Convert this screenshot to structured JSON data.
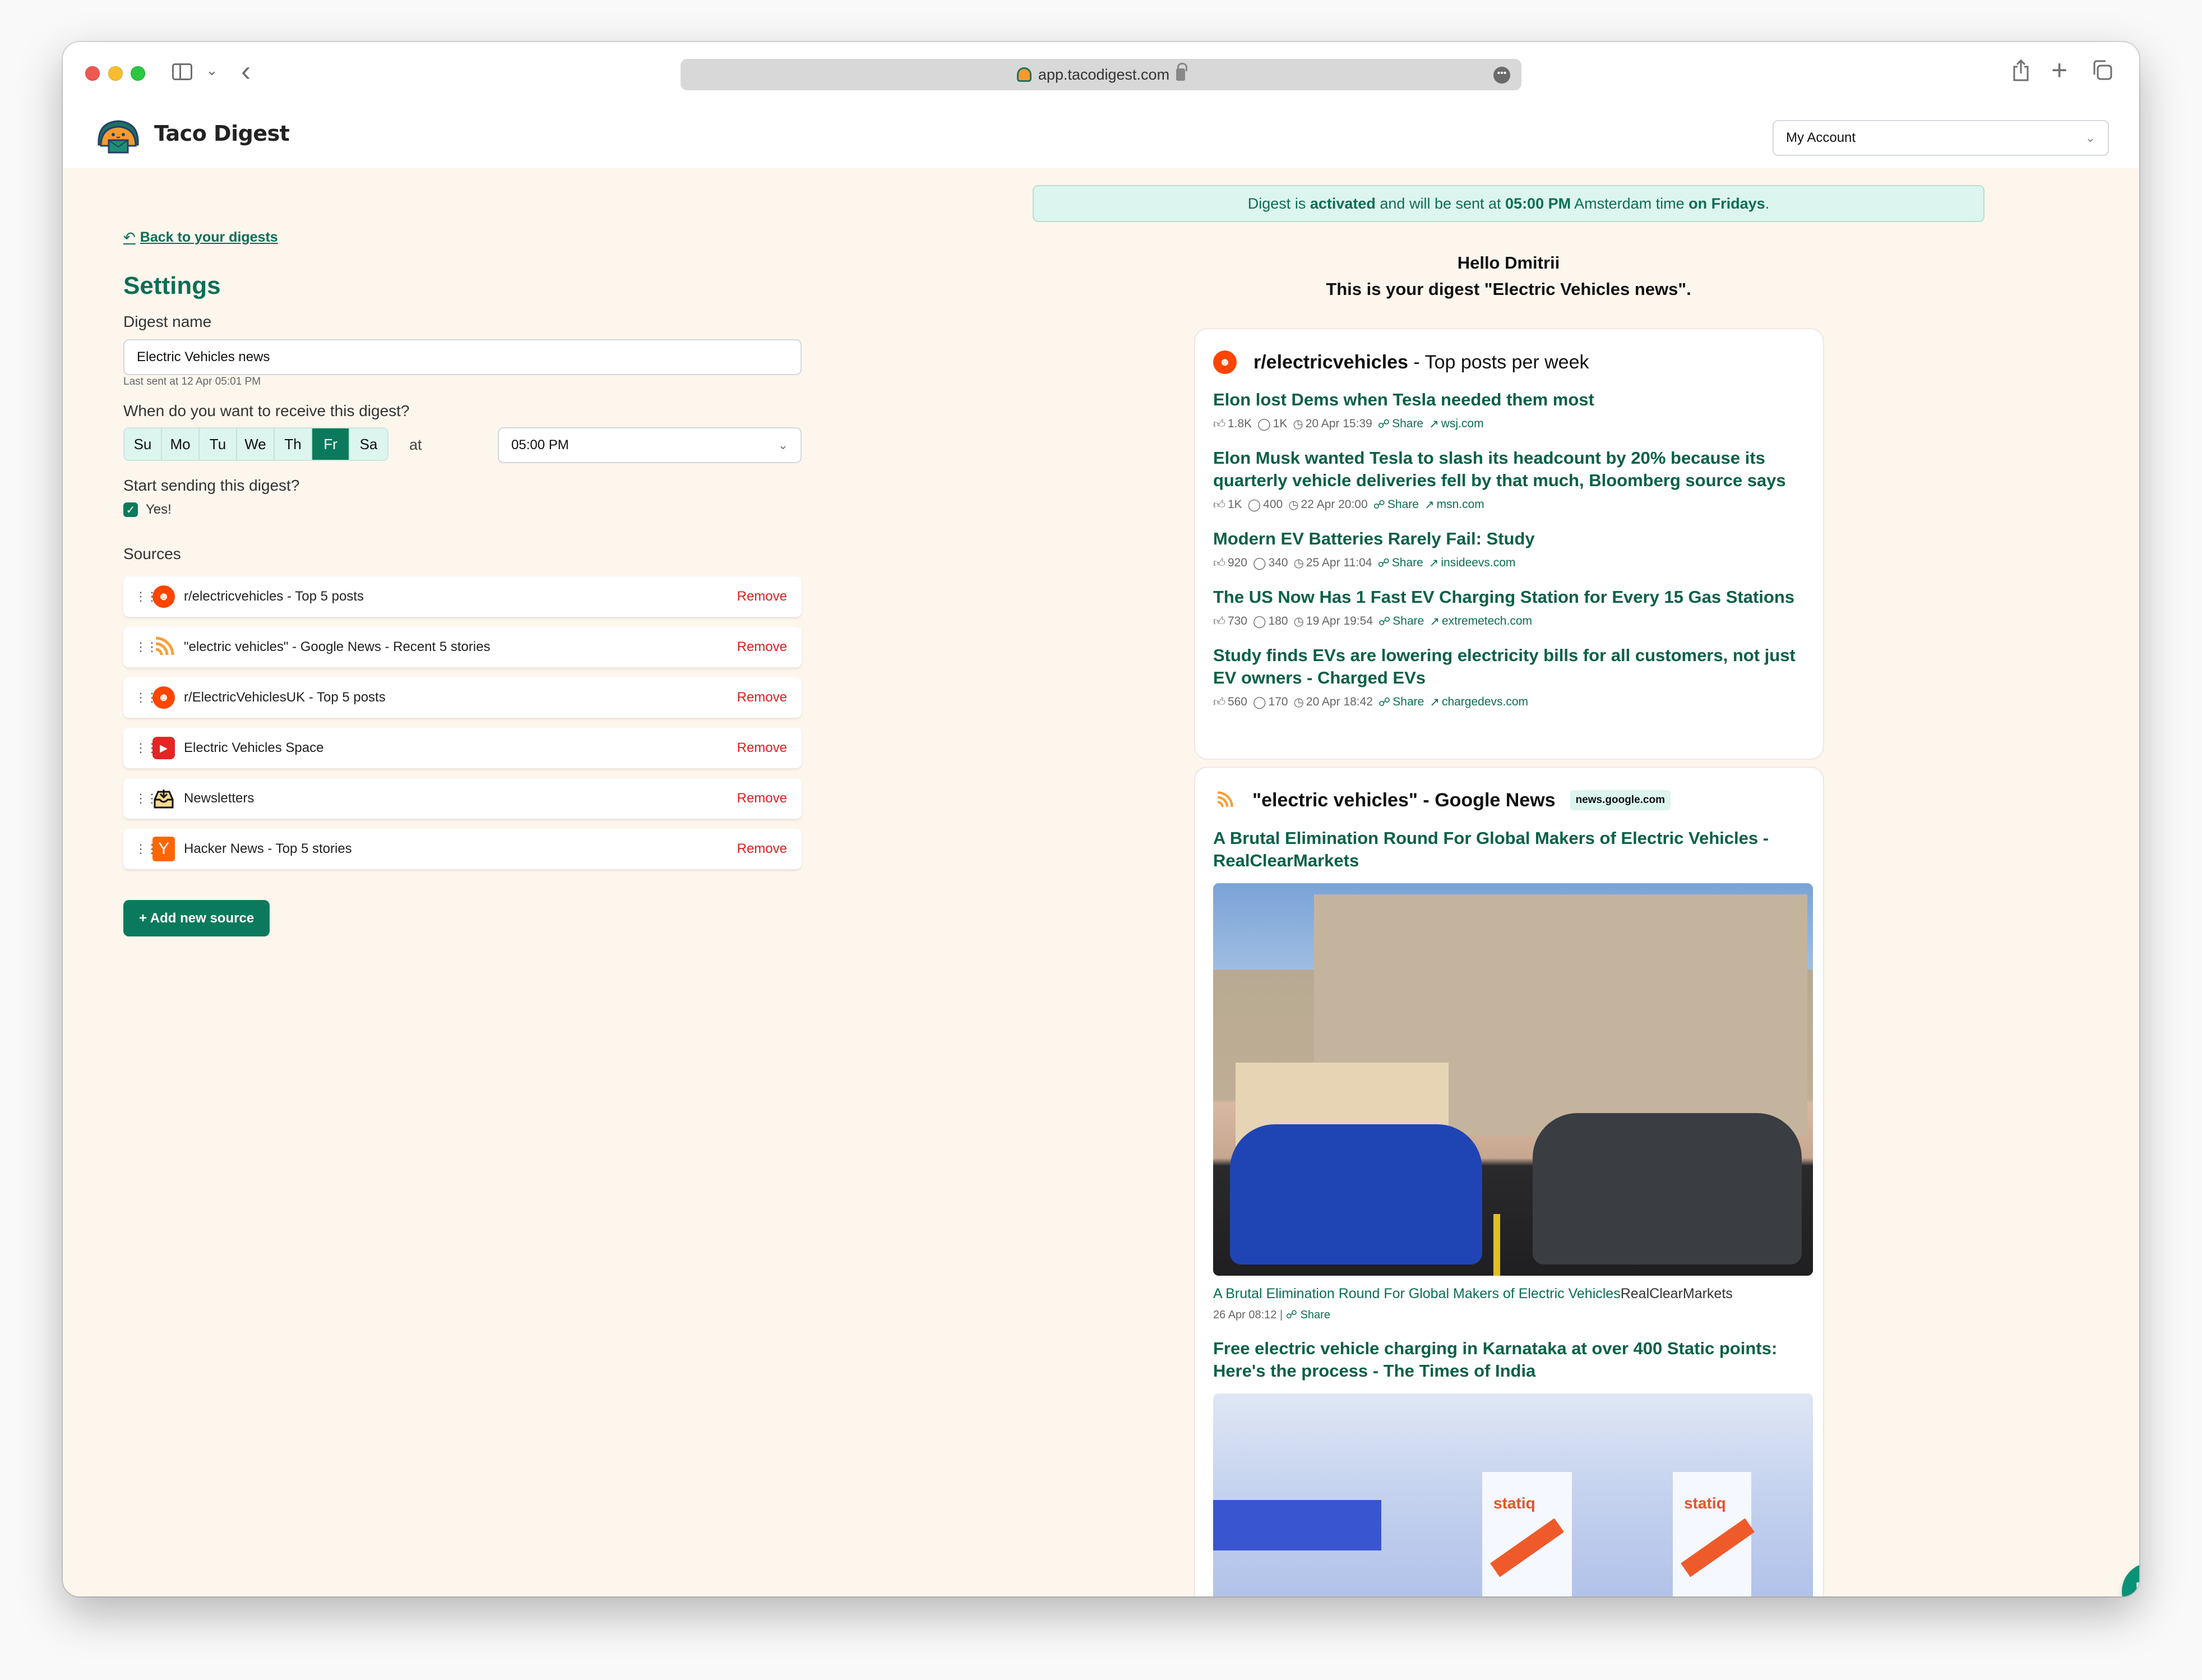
{
  "browser": {
    "url": "app.tacodigest.com"
  },
  "header": {
    "brand": "Taco Digest",
    "account_label": "My Account"
  },
  "settings": {
    "back_link": "Back to your digests",
    "title": "Settings",
    "digest_name_label": "Digest name",
    "digest_name_value": "Electric Vehicles news",
    "last_sent": "Last sent at 12 Apr 05:01 PM",
    "when_label": "When do you want to receive this digest?",
    "days": [
      {
        "label": "Su",
        "selected": false
      },
      {
        "label": "Mo",
        "selected": false
      },
      {
        "label": "Tu",
        "selected": false
      },
      {
        "label": "We",
        "selected": false
      },
      {
        "label": "Th",
        "selected": false
      },
      {
        "label": "Fr",
        "selected": true
      },
      {
        "label": "Sa",
        "selected": false
      }
    ],
    "at_label": "at",
    "time_value": "05:00 PM",
    "start_label": "Start sending this digest?",
    "start_checkbox_label": "Yes!",
    "start_checked": true,
    "sources_label": "Sources",
    "sources": [
      {
        "name": "r/electricvehicles - Top 5 posts",
        "icon": "reddit-icon",
        "remove": "Remove"
      },
      {
        "name": "\"electric vehicles\" - Google News - Recent 5 stories",
        "icon": "rss-icon",
        "remove": "Remove"
      },
      {
        "name": "r/ElectricVehiclesUK - Top 5 posts",
        "icon": "reddit-icon",
        "remove": "Remove"
      },
      {
        "name": "Electric Vehicles Space",
        "icon": "youtube-icon",
        "remove": "Remove"
      },
      {
        "name": "Newsletters",
        "icon": "inbox-icon",
        "remove": "Remove"
      },
      {
        "name": "Hacker News - Top 5 stories",
        "icon": "hacker-news-icon",
        "remove": "Remove"
      }
    ],
    "add_source_label": "+ Add new source"
  },
  "preview": {
    "banner": {
      "p1": "Digest is ",
      "b1": "activated",
      "p2": " and will be sent at ",
      "b2": "05:00 PM",
      "p3": " Amsterdam time ",
      "b3": "on Fridays",
      "p4": "."
    },
    "greeting": "Hello Dmitrii",
    "intro": "This is your digest \"Electric Vehicles news\".",
    "reddit_section": {
      "subreddit": "r/electricvehicles",
      "suffix": " - Top posts per week",
      "posts": [
        {
          "title": "Elon lost Dems when Tesla needed them most",
          "upvotes": "1.8K",
          "comments": "1K",
          "date": "20 Apr 15:39",
          "share": "Share",
          "domain": "wsj.com"
        },
        {
          "title": "Elon Musk wanted Tesla to slash its headcount by 20% because its quarterly vehicle deliveries fell by that much, Bloomberg source says",
          "upvotes": "1K",
          "comments": "400",
          "date": "22 Apr 20:00",
          "share": "Share",
          "domain": "msn.com"
        },
        {
          "title": "Modern EV Batteries Rarely Fail: Study",
          "upvotes": "920",
          "comments": "340",
          "date": "25 Apr 11:04",
          "share": "Share",
          "domain": "insideevs.com"
        },
        {
          "title": "The US Now Has 1 Fast EV Charging Station for Every 15 Gas Stations",
          "upvotes": "730",
          "comments": "180",
          "date": "19 Apr 19:54",
          "share": "Share",
          "domain": "extremetech.com"
        },
        {
          "title": "Study finds EVs are lowering electricity bills for all customers, not just EV owners - Charged EVs",
          "upvotes": "560",
          "comments": "170",
          "date": "20 Apr 18:42",
          "share": "Share",
          "domain": "chargedevs.com"
        }
      ]
    },
    "news_section": {
      "title": "\"electric vehicles\" - Google News",
      "badge": "news.google.com",
      "items": [
        {
          "title": "A Brutal Elimination Round For Global Makers of Electric Vehicles - RealClearMarkets",
          "caption_link": "A Brutal Elimination Round For Global Makers of Electric Vehicles",
          "caption_source": "RealClearMarkets",
          "date": "26 Apr 08:12 | ",
          "share": "Share"
        },
        {
          "title": "Free electric vehicle charging in Karnataka at over 400 Static points: Here's the process - The Times of India"
        }
      ]
    }
  }
}
